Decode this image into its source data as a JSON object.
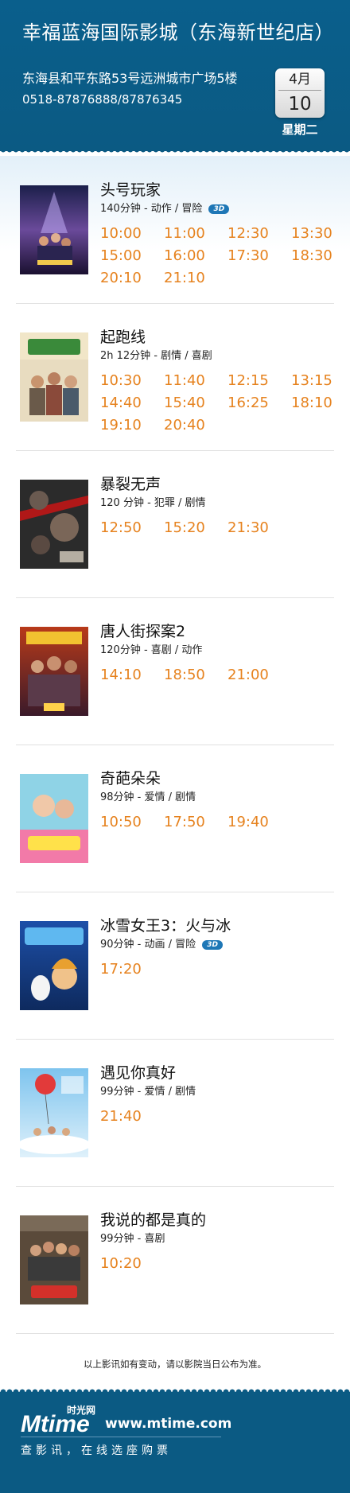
{
  "header": {
    "cinema_name": "幸福蓝海国际影城（东海新世纪店）",
    "address": "东海县和平东路53号远洲城市广场5楼",
    "phone": "0518-87876888/87876345",
    "date": {
      "month": "4月",
      "day": "10",
      "weekday": "星期二"
    }
  },
  "colors": {
    "header_bg": "#0b5a83",
    "showtime": "#e6821e",
    "badge_3d": "#1e77b6"
  },
  "movies": [
    {
      "title": "头号玩家",
      "meta": "140分钟 - 动作 / 冒险",
      "badge": "3D",
      "times": [
        "10:00",
        "11:00",
        "12:30",
        "13:30",
        "15:00",
        "16:00",
        "17:30",
        "18:30",
        "20:10",
        "21:10"
      ]
    },
    {
      "title": "起跑线",
      "meta": "2h 12分钟 - 剧情 / 喜剧",
      "times": [
        "10:30",
        "11:40",
        "12:15",
        "13:15",
        "14:40",
        "15:40",
        "16:25",
        "18:10",
        "19:10",
        "20:40"
      ]
    },
    {
      "title": "暴裂无声",
      "meta": "120 分钟 - 犯罪 / 剧情",
      "times": [
        "12:50",
        "15:20",
        "21:30"
      ]
    },
    {
      "title": "唐人街探案2",
      "meta": "120分钟 - 喜剧 / 动作",
      "times": [
        "14:10",
        "18:50",
        "21:00"
      ]
    },
    {
      "title": "奇葩朵朵",
      "meta": "98分钟 - 爱情 / 剧情",
      "times": [
        "10:50",
        "17:50",
        "19:40"
      ]
    },
    {
      "title": "冰雪女王3：火与冰",
      "meta": "90分钟 - 动画 / 冒险",
      "badge": "3D",
      "times": [
        "17:20"
      ]
    },
    {
      "title": "遇见你真好",
      "meta": "99分钟 - 爱情 / 剧情",
      "times": [
        "21:40"
      ]
    },
    {
      "title": "我说的都是真的",
      "meta": "99分钟 - 喜剧",
      "times": [
        "10:20"
      ]
    }
  ],
  "notice": "以上影讯如有变动，请以影院当日公布为准。",
  "footer": {
    "brand_cn": "时光网",
    "brand_logo_text": "Mtime",
    "website": "www.mtime.com",
    "slogan": "查影讯，在线选座购票"
  }
}
